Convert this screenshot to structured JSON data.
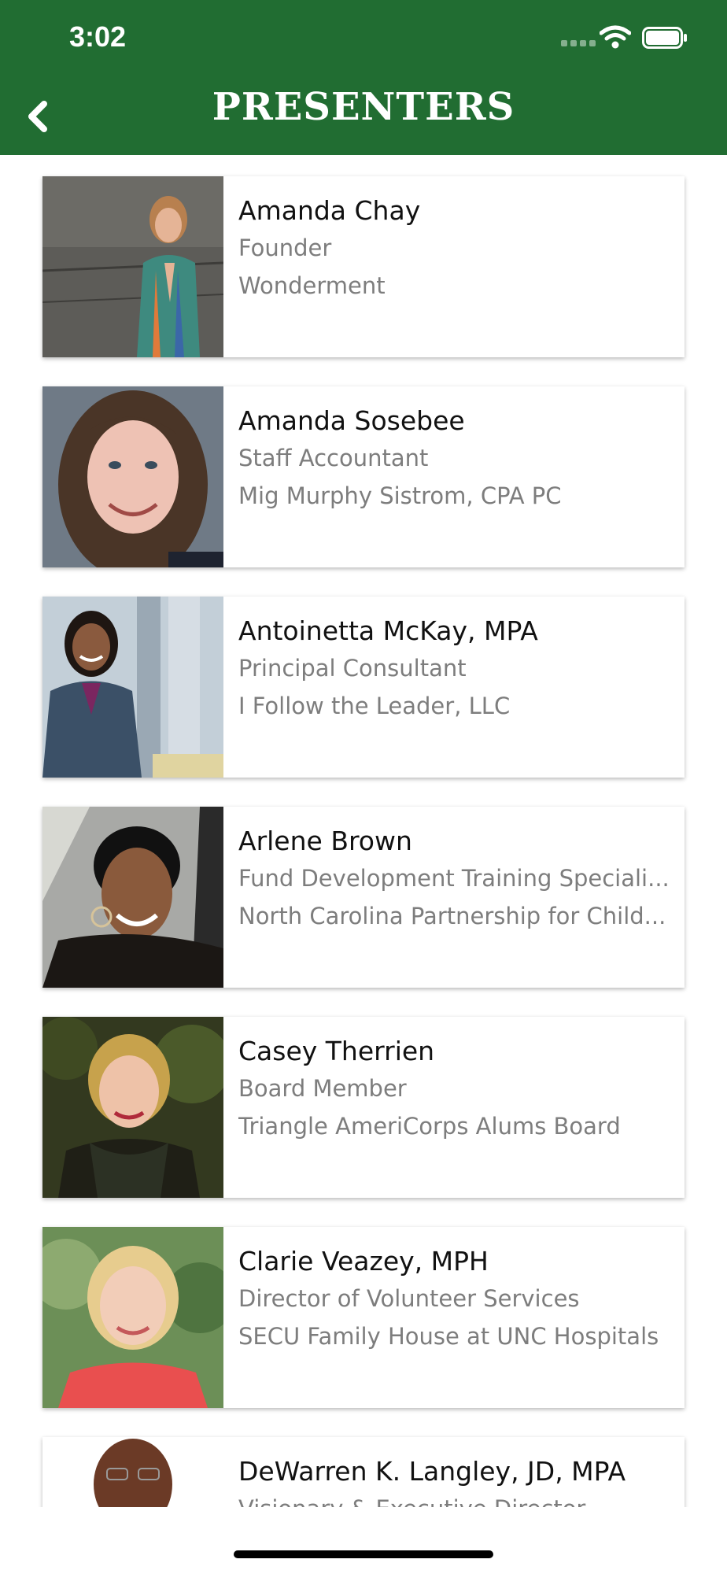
{
  "status_bar": {
    "time": "3:02"
  },
  "header": {
    "title": "PRESENTERS"
  },
  "presenters": [
    {
      "name": "Amanda Chay",
      "role": "Founder",
      "org": "Wonderment"
    },
    {
      "name": "Amanda Sosebee",
      "role": "Staff Accountant",
      "org": "Mig Murphy Sistrom, CPA PC"
    },
    {
      "name": "Antoinetta McKay, MPA",
      "role": "Principal Consultant",
      "org": "I Follow the Leader, LLC"
    },
    {
      "name": "Arlene Brown",
      "role": "Fund Development Training Speciali...",
      "org": "North Carolina Partnership for Child..."
    },
    {
      "name": "Casey Therrien",
      "role": "Board Member",
      "org": "Triangle AmeriCorps Alums Board"
    },
    {
      "name": "Clarie Veazey, MPH",
      "role": "Director of Volunteer Services",
      "org": "SECU Family House at UNC Hospitals"
    },
    {
      "name": "DeWarren K. Langley, JD, MPA",
      "role": "Visionary & Executive Director",
      "org": ""
    }
  ]
}
